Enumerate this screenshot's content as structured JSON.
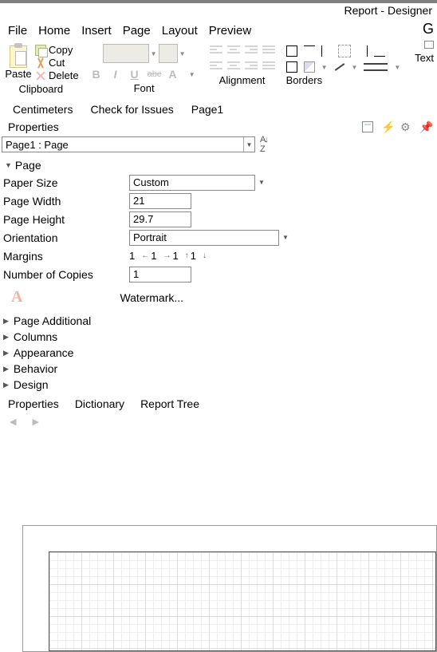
{
  "app": {
    "title": "Report - Designer"
  },
  "menu": {
    "file": "File",
    "home": "Home",
    "insert": "Insert",
    "page": "Page",
    "layout": "Layout",
    "preview": "Preview"
  },
  "ribbon": {
    "clipboard": {
      "paste": "Paste",
      "copy": "Copy",
      "cut": "Cut",
      "delete": "Delete",
      "label": "Clipboard"
    },
    "font": {
      "label": "Font"
    },
    "alignment": {
      "label": "Alignment"
    },
    "borders": {
      "label": "Borders"
    },
    "text": {
      "g": "G",
      "label": "Text"
    }
  },
  "bar2": {
    "centimeters": "Centimeters",
    "check": "Check for Issues",
    "page1": "Page1"
  },
  "panel": {
    "properties": "Properties",
    "selector": "Page1 : Page",
    "section_page": "Page",
    "paper_size_label": "Paper Size",
    "paper_size_value": "Custom",
    "page_width_label": "Page Width",
    "page_width_value": "21",
    "page_height_label": "Page Height",
    "page_height_value": "29.7",
    "orientation_label": "Orientation",
    "orientation_value": "Portrait",
    "margins_label": "Margins",
    "margins": {
      "left": "1",
      "right": "1",
      "top": "1",
      "bottom": "1"
    },
    "copies_label": "Number of Copies",
    "copies_value": "1",
    "watermark": "Watermark...",
    "sections": {
      "page_additional": "Page Additional",
      "columns": "Columns",
      "appearance": "Appearance",
      "behavior": "Behavior",
      "design": "Design"
    }
  },
  "tabs": {
    "properties": "Properties",
    "dictionary": "Dictionary",
    "report_tree": "Report Tree"
  }
}
